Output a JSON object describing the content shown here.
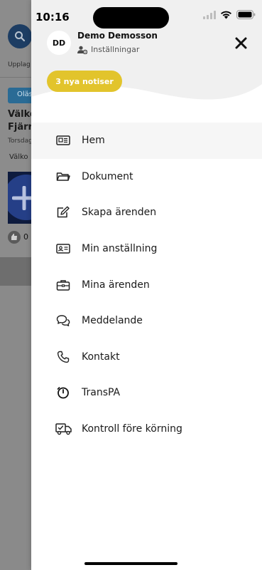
{
  "status_bar": {
    "time": "10:16"
  },
  "background": {
    "upplag_label": "Upplag",
    "olas_label": "Oläs",
    "title_line1": "Välko",
    "title_line2": "Fjärr",
    "date_label": "Torsdag",
    "welcome_label": "Välko",
    "like_count": "0"
  },
  "drawer": {
    "user": {
      "initials": "DD",
      "name": "Demo Demosson",
      "settings_label": "Inställningar"
    },
    "notifications_label": "3 nya notiser",
    "accent_color": "#e2c42c",
    "menu": [
      {
        "label": "Hem",
        "icon": "newspaper-icon",
        "active": true
      },
      {
        "label": "Dokument",
        "icon": "folder-icon"
      },
      {
        "label": "Skapa ärenden",
        "icon": "edit-icon"
      },
      {
        "label": "Min anställning",
        "icon": "id-card-icon"
      },
      {
        "label": "Mina ärenden",
        "icon": "briefcase-icon"
      },
      {
        "label": "Meddelande",
        "icon": "chat-bubbles-icon"
      },
      {
        "label": "Kontakt",
        "icon": "phone-icon"
      },
      {
        "label": "TransPA",
        "icon": "timer-icon"
      },
      {
        "label": "Kontroll före körning",
        "icon": "truck-icon"
      }
    ]
  }
}
